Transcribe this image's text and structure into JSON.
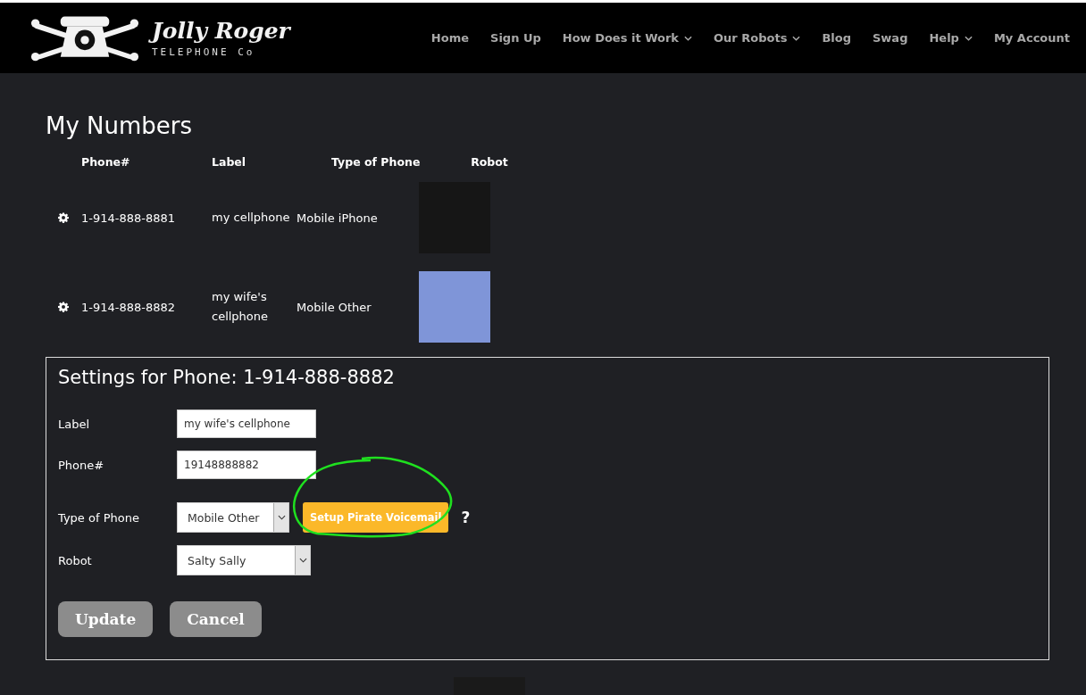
{
  "brand": {
    "name": "Jolly Roger",
    "tagline": "TELEPHONE Co"
  },
  "nav": [
    {
      "label": "Home",
      "dropdown": false
    },
    {
      "label": "Sign Up",
      "dropdown": false
    },
    {
      "label": "How Does it Work",
      "dropdown": true
    },
    {
      "label": "Our Robots",
      "dropdown": true
    },
    {
      "label": "Blog",
      "dropdown": false
    },
    {
      "label": "Swag",
      "dropdown": false
    },
    {
      "label": "Help",
      "dropdown": true
    },
    {
      "label": "My Account",
      "dropdown": false
    }
  ],
  "page_title": "My Numbers",
  "table": {
    "columns": [
      "Phone#",
      "Label",
      "Type of Phone",
      "Robot"
    ],
    "rows": [
      {
        "phone": "1-914-888-8881",
        "label": "my cellphone",
        "type": "Mobile iPhone"
      },
      {
        "phone": "1-914-888-8882",
        "label": "my wife's cellphone",
        "type": "Mobile Other"
      }
    ]
  },
  "settings": {
    "title": "Settings for Phone: 1-914-888-8882",
    "fields": [
      {
        "kind": "text",
        "label": "Label",
        "value": "my wife's cellphone"
      },
      {
        "kind": "text",
        "label": "Phone#",
        "value": "19148888882"
      },
      {
        "kind": "select",
        "label": "Type of Phone",
        "value": "Mobile Other",
        "action": "Setup Pirate Voicemail",
        "help": "?"
      },
      {
        "kind": "select",
        "label": "Robot",
        "value": "Salty Sally"
      }
    ],
    "buttons": [
      {
        "label": "Update",
        "disabled": true
      },
      {
        "label": "Cancel",
        "disabled": true
      }
    ]
  }
}
